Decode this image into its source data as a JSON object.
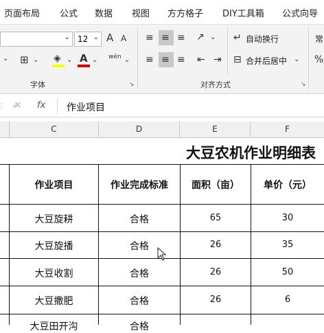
{
  "tabs": [
    "页面布局",
    "公式",
    "数据",
    "视图",
    "方方格子",
    "DIY工具箱",
    "公式向导"
  ],
  "font": {
    "size": "12",
    "grow_icon": "A",
    "shrink_icon": "A",
    "group_label": "字体"
  },
  "align": {
    "wrap_label": "自动换行",
    "merge_label": "合并后居中",
    "group_label": "对齐方式"
  },
  "cut_label": "常",
  "formula": {
    "fx": "fx",
    "content": "作业项目",
    "check": "✓"
  },
  "columns": [
    "C",
    "D",
    "E",
    "F"
  ],
  "sheet": {
    "title": "大豆农机作业明细表",
    "headers": [
      "作业项目",
      "作业完成标准",
      "面积（亩）",
      "单价（元）"
    ],
    "rows": [
      [
        "大豆旋耕",
        "合格",
        "65",
        "30"
      ],
      [
        "大豆旋播",
        "合格",
        "26",
        "35"
      ],
      [
        "大豆收割",
        "合格",
        "26",
        "50"
      ],
      [
        "大豆撒肥",
        "合格",
        "26",
        "6"
      ],
      [
        "大豆田开沟",
        "合格",
        "",
        ""
      ]
    ]
  },
  "colors": {
    "accent": "#217346",
    "font_color": "#e00000",
    "highlight": "#ffff00"
  }
}
